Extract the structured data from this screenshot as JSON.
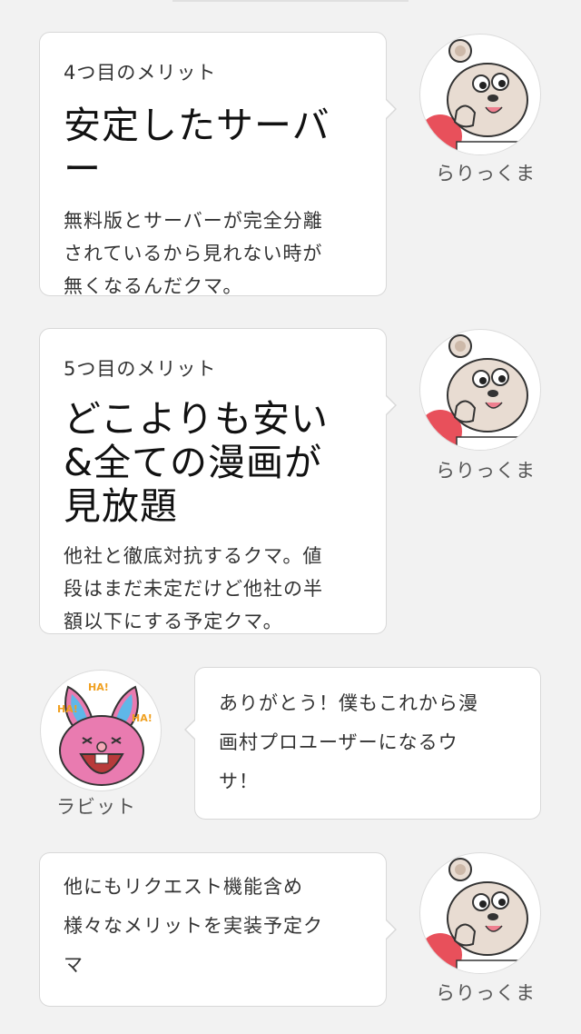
{
  "messages": [
    {
      "kicker": "4つ目のメリット",
      "headline": [
        "安定したサーバ",
        "ー"
      ],
      "body": [
        "無料版とサーバーが完全分離",
        "されているから見れない時が",
        "無くなるんだクマ。"
      ],
      "speaker": "らりっくま"
    },
    {
      "kicker": "5つ目のメリット",
      "headline": [
        "どこよりも安い",
        "&全ての漫画が",
        "見放題"
      ],
      "body": [
        "他社と徹底対抗するクマ。値",
        "段はまだ未定だけど他社の半",
        "額以下にする予定クマ。"
      ],
      "speaker": "らりっくま"
    },
    {
      "text": [
        "ありがとう！僕もこれから漫",
        "画村プロユーザーになるウ",
        "サ！"
      ],
      "speaker": "ラビット",
      "sticker_text": [
        "HA!",
        "HA!",
        "HA!"
      ]
    },
    {
      "text": [
        "他にもリクエスト機能含め",
        "様々なメリットを実装予定ク",
        "マ"
      ],
      "speaker": "らりっくま"
    }
  ],
  "colors": {
    "background": "#f2f2f2",
    "bubble": "#ffffff",
    "bubble_border": "#d8d8d8",
    "bear_fur": "#e8dcd2",
    "rabbit_face": "#e97bb0",
    "rabbit_ears": "#5fb7e8"
  },
  "icons": {
    "bear_avatar": "bear-avatar-icon",
    "rabbit_avatar": "rabbit-avatar-icon"
  }
}
